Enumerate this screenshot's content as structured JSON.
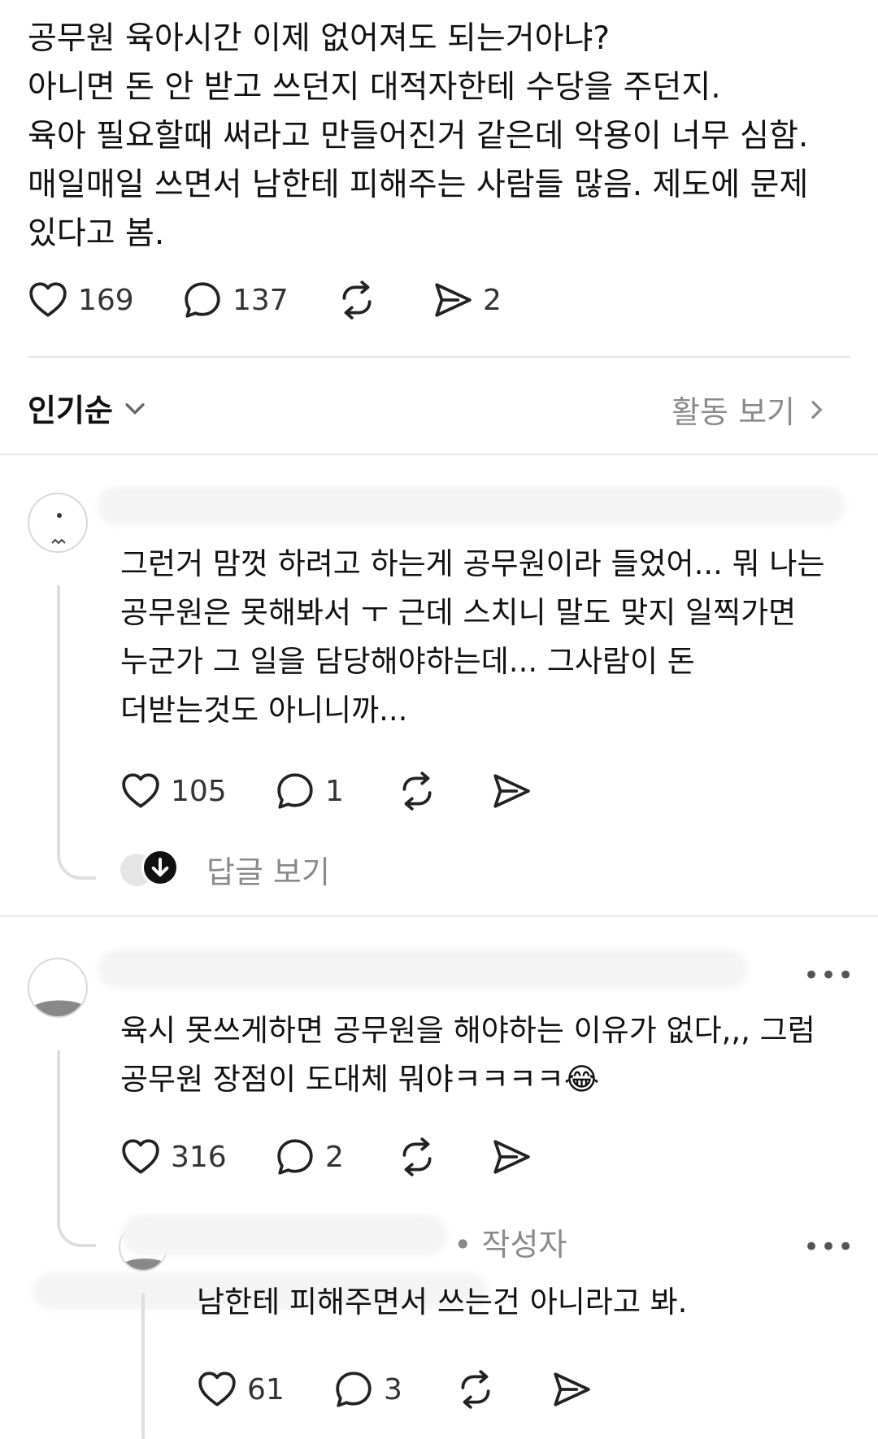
{
  "post": {
    "lines": [
      "공무원 육아시간 이제 없어져도 되는거아냐?",
      "아니면 돈 안 받고 쓰던지 대적자한테 수당을 주던지.",
      "육아 필요할때 써라고 만들어진거 같은데 악용이 너무 심함.",
      "매일매일 쓰면서 남한테 피해주는 사람들 많음. 제도에 문제",
      "있다고 봄."
    ],
    "likes": "169",
    "comments": "137",
    "shares": "2"
  },
  "sort": {
    "label": "인기순"
  },
  "activity": {
    "label": "활동 보기"
  },
  "comments": [
    {
      "lines": [
        "그런거 맘껏 하려고 하는게 공무원이라 들었어... 뭐 나는",
        "공무원은 못해봐서 ㅜ 근데 스치니 말도 맞지 일찍가면",
        "누군가 그 일을 담당해야하는데... 그사람이 돈",
        "더받는것도 아니니까..."
      ],
      "likes": "105",
      "replies": "1",
      "replies_link": "답글 보기"
    },
    {
      "lines": [
        "육시 못쓰게하면 공무원을 해야하는 이유가 없다,,, 그럼",
        "공무원 장점이 도대체 뭐야ㅋㅋㅋㅋ😂"
      ],
      "likes": "316",
      "replies": "2"
    }
  ],
  "reply": {
    "author_tag": "• 작성자",
    "text": "남한테 피해주면서 쓰는건 아니라고 봐.",
    "likes": "61",
    "replies": "3"
  },
  "icons": {
    "like": "heart-icon",
    "comment": "speech-bubble-icon",
    "repost": "repost-icon",
    "share": "send-icon",
    "more": "more-dots-icon",
    "chevron_down": "chevron-down-icon",
    "chevron_right": "chevron-right-icon",
    "arrow_down": "arrow-down-circle-icon"
  }
}
